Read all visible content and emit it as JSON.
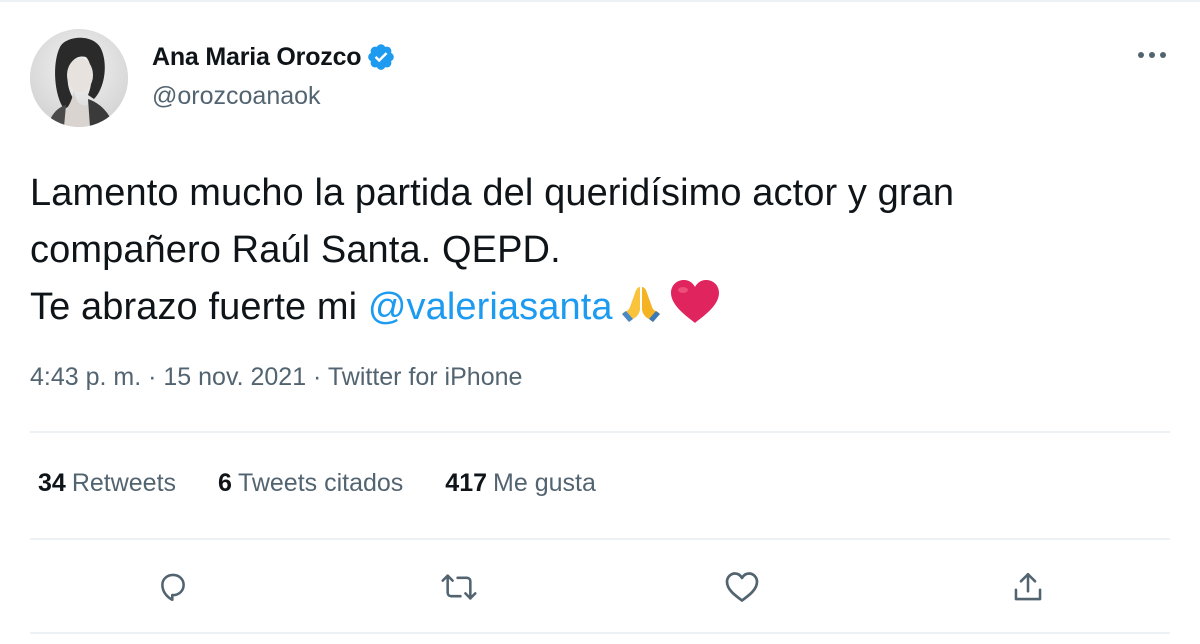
{
  "author": {
    "display_name": "Ana Maria Orozco",
    "handle": "@orozcoanaok",
    "verified": true
  },
  "tweet": {
    "line1": "Lamento mucho la partida del queridísimo actor y gran",
    "line2": "compañero Raúl Santa. QEPD.",
    "line3_prefix": "Te abrazo fuerte mi ",
    "mention": "@valeriasanta",
    "emojis": [
      "folded-hands",
      "red-heart"
    ]
  },
  "meta": {
    "time": "4:43 p. m.",
    "separator": " · ",
    "date": "15 nov. 2021",
    "source": "Twitter for iPhone"
  },
  "stats": {
    "retweets_count": "34",
    "retweets_label": "Retweets",
    "quotes_count": "6",
    "quotes_label": "Tweets citados",
    "likes_count": "417",
    "likes_label": "Me gusta"
  },
  "colors": {
    "accent": "#1d9bf0",
    "secondary_text": "#536471",
    "primary_text": "#0f1419",
    "heart": "#e0245e"
  },
  "icons": [
    "more-icon",
    "verified-badge-icon",
    "reply-icon",
    "retweet-icon",
    "like-icon",
    "share-icon"
  ]
}
